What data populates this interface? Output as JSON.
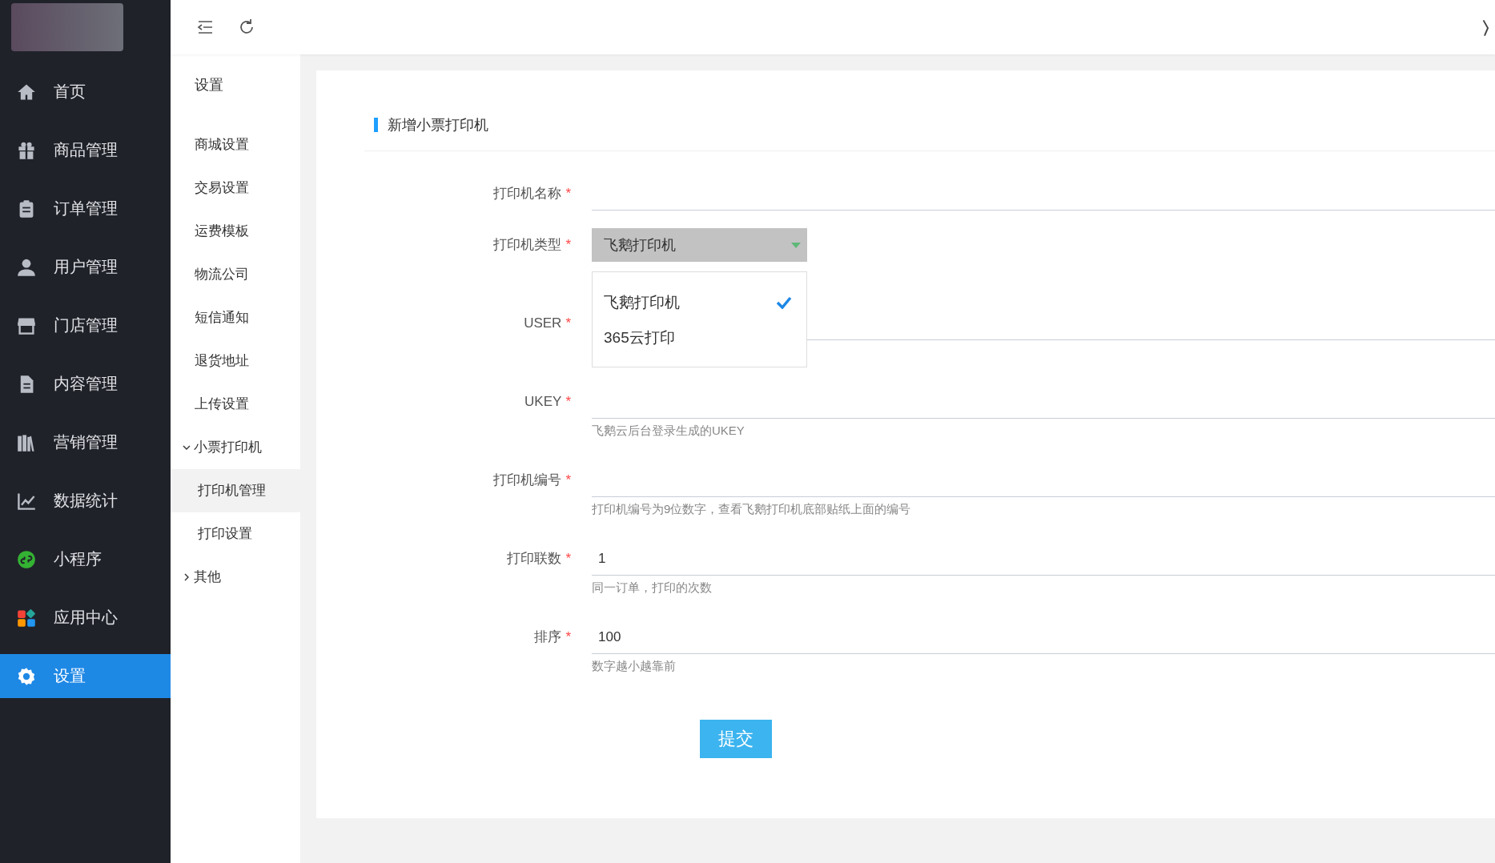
{
  "sidebar": {
    "items": [
      {
        "label": "首页",
        "selected": false
      },
      {
        "label": "商品管理",
        "selected": false
      },
      {
        "label": "订单管理",
        "selected": false
      },
      {
        "label": "用户管理",
        "selected": false
      },
      {
        "label": "门店管理",
        "selected": false
      },
      {
        "label": "内容管理",
        "selected": false
      },
      {
        "label": "营销管理",
        "selected": false
      },
      {
        "label": "数据统计",
        "selected": false
      },
      {
        "label": "小程序",
        "selected": false
      },
      {
        "label": "应用中心",
        "selected": false
      },
      {
        "label": "设置",
        "selected": true
      }
    ]
  },
  "submenu": {
    "title": "设置",
    "items": [
      {
        "label": "商城设置",
        "selected": false
      },
      {
        "label": "交易设置",
        "selected": false
      },
      {
        "label": "运费模板",
        "selected": false
      },
      {
        "label": "物流公司",
        "selected": false
      },
      {
        "label": "短信通知",
        "selected": false
      },
      {
        "label": "退货地址",
        "selected": false
      },
      {
        "label": "上传设置",
        "selected": false
      },
      {
        "label": "小票打印机",
        "expanded": true,
        "children": [
          {
            "label": "打印机管理",
            "selected": true
          },
          {
            "label": "打印设置",
            "selected": false
          }
        ]
      },
      {
        "label": "其他",
        "expanded": false
      }
    ]
  },
  "form": {
    "title": "新增小票打印机",
    "required_mark": "*",
    "fields": [
      {
        "kind": "input",
        "label": "打印机名称",
        "required": true
      },
      {
        "kind": "select",
        "label": "打印机类型",
        "required": true,
        "value": "飞鹅打印机",
        "open": true,
        "options": [
          {
            "label": "飞鹅打印机",
            "selected": true
          },
          {
            "label": "365云打印",
            "selected": false
          }
        ]
      },
      {
        "kind": "input",
        "label": "USER",
        "required": true
      },
      {
        "kind": "input",
        "label": "UKEY",
        "required": true,
        "hint": "飞鹅云后台登录生成的UKEY"
      },
      {
        "kind": "input",
        "label": "打印机编号",
        "required": true,
        "hint": "打印机编号为9位数字，查看飞鹅打印机底部贴纸上面的编号"
      },
      {
        "kind": "input",
        "label": "打印联数",
        "required": true,
        "value": "1",
        "hint": "同一订单，打印的次数"
      },
      {
        "kind": "input",
        "label": "排序",
        "required": true,
        "value": "100",
        "hint": "数字越小越靠前"
      }
    ],
    "submit": "提交"
  }
}
